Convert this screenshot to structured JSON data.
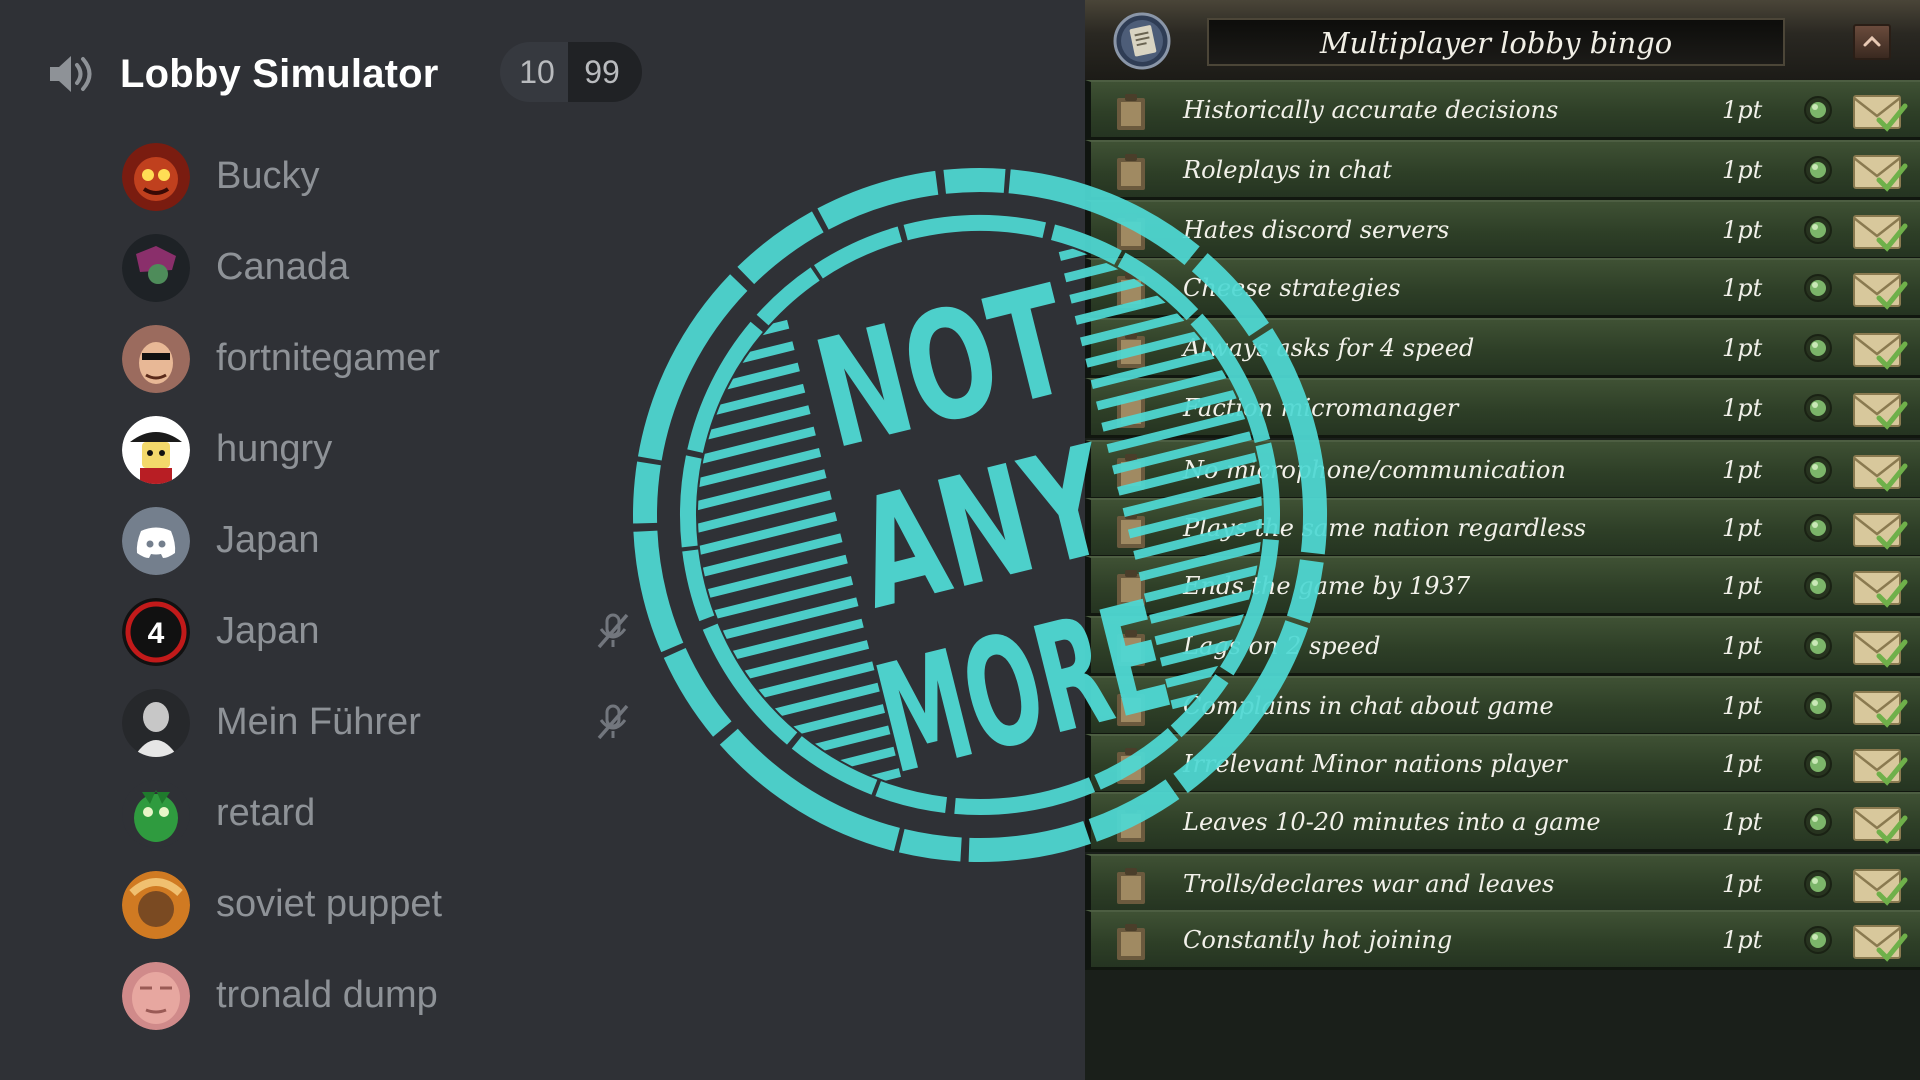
{
  "discord": {
    "channel": {
      "icon": "speaker-icon",
      "name": "Lobby Simulator",
      "user_count": "10",
      "user_limit": "99"
    },
    "users": [
      {
        "name": "Bucky",
        "avatar": "red-face",
        "muted": false
      },
      {
        "name": "Canada",
        "avatar": "dark-character",
        "muted": false
      },
      {
        "name": "fortnitegamer",
        "avatar": "cartoon-face",
        "muted": false
      },
      {
        "name": "hungry",
        "avatar": "cartoon-soldier",
        "muted": false
      },
      {
        "name": "Japan",
        "avatar": "default-discord",
        "muted": false
      },
      {
        "name": "Japan",
        "avatar": "number-4-badge",
        "avatar_text": "4",
        "muted": true
      },
      {
        "name": "Mein Führer",
        "avatar": "portrait-grey",
        "muted": true
      },
      {
        "name": "retard",
        "avatar": "green-creature",
        "muted": false
      },
      {
        "name": "soviet puppet",
        "avatar": "orange-character",
        "muted": false
      },
      {
        "name": "tronald dump",
        "avatar": "pink-face",
        "muted": false
      }
    ],
    "colors": {
      "background": "#2f3136",
      "username": "#8e9297",
      "title": "#ffffff"
    }
  },
  "bingo": {
    "title": "Multiplayer lobby bingo",
    "header_icon": "decision-scroll-icon",
    "collapse_icon": "chevron-up-icon",
    "rows": [
      {
        "label": "Historically accurate decisions",
        "points": "1pt"
      },
      {
        "label": "Roleplays in chat",
        "points": "1pt"
      },
      {
        "label": "Hates discord servers",
        "points": "1pt"
      },
      {
        "label": "Cheese strategies",
        "points": "1pt"
      },
      {
        "label": "Always asks for 4 speed",
        "points": "1pt"
      },
      {
        "label": "Faction micromanager",
        "points": "1pt"
      },
      {
        "label": "No microphone/communication",
        "points": "1pt"
      },
      {
        "label": "Plays the same nation regardless",
        "points": "1pt"
      },
      {
        "label": "Ends the game by 1937",
        "points": "1pt"
      },
      {
        "label": "Lags on 2 speed",
        "points": "1pt"
      },
      {
        "label": "Complains in chat about game",
        "points": "1pt"
      },
      {
        "label": "Irrelevant Minor nations player",
        "points": "1pt"
      },
      {
        "label": "Leaves 10-20 minutes into a game",
        "points": "1pt"
      },
      {
        "label": "Trolls/declares war and leaves",
        "points": "1pt"
      },
      {
        "label": "Constantly hot joining",
        "points": "1pt"
      }
    ],
    "colors": {
      "row": "#2e3f27",
      "text": "#f2f1ea"
    }
  },
  "stamp": {
    "lines": [
      "NOT",
      "ANY",
      "MORE"
    ],
    "color": "#4fd9d4"
  }
}
